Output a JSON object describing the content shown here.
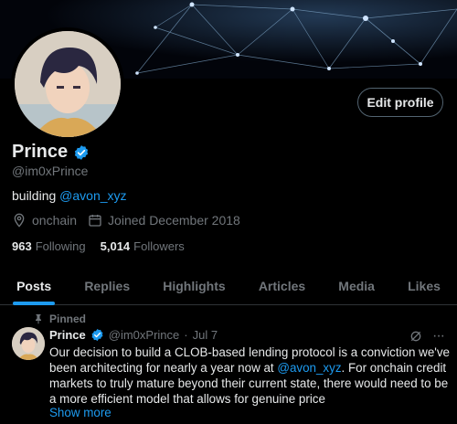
{
  "profile": {
    "edit_label": "Edit profile",
    "name": "Prince",
    "handle": "@im0xPrince",
    "bio_prefix": "building ",
    "bio_link": "@avon_xyz",
    "location": "onchain",
    "joined": "Joined December 2018",
    "following_count": "963",
    "following_label": "Following",
    "followers_count": "5,014",
    "followers_label": "Followers"
  },
  "tabs": [
    {
      "label": "Posts"
    },
    {
      "label": "Replies"
    },
    {
      "label": "Highlights"
    },
    {
      "label": "Articles"
    },
    {
      "label": "Media"
    },
    {
      "label": "Likes"
    }
  ],
  "pinned_post": {
    "pinned_label": "Pinned",
    "author": "Prince",
    "handle": "@im0xPrince",
    "separator": "·",
    "date": "Jul 7",
    "text_1": "Our decision to build a CLOB-based lending protocol is a conviction we've been architecting for nearly a year now at ",
    "text_link": "@avon_xyz",
    "text_2": ". For onchain credit markets to truly mature beyond their current state, there would need to be a more efficient model that allows for genuine price",
    "show_more": "Show more",
    "more_icon": "···"
  },
  "colors": {
    "accent": "#1d9bf0",
    "muted": "#71767b",
    "text": "#e7e9ea",
    "border": "#2f3336"
  }
}
